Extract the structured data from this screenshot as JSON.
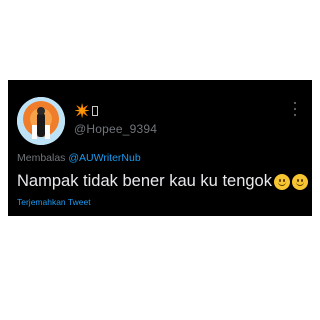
{
  "tweet": {
    "display_name_emoji": "✴️",
    "handle": "@Hopee_9394",
    "reply_prefix": "Membalas",
    "reply_mention": "@AUWriterNub",
    "text": "Nampak tidak bener kau ku tengok",
    "emojis": [
      "slightly-smiling-face-icon",
      "smiling-face-icon"
    ],
    "translate_label": "Terjemahkan Tweet"
  },
  "colors": {
    "card_bg": "#000000",
    "text_primary": "#e7e9ea",
    "text_secondary": "#71767b",
    "accent": "#1d9bf0"
  }
}
